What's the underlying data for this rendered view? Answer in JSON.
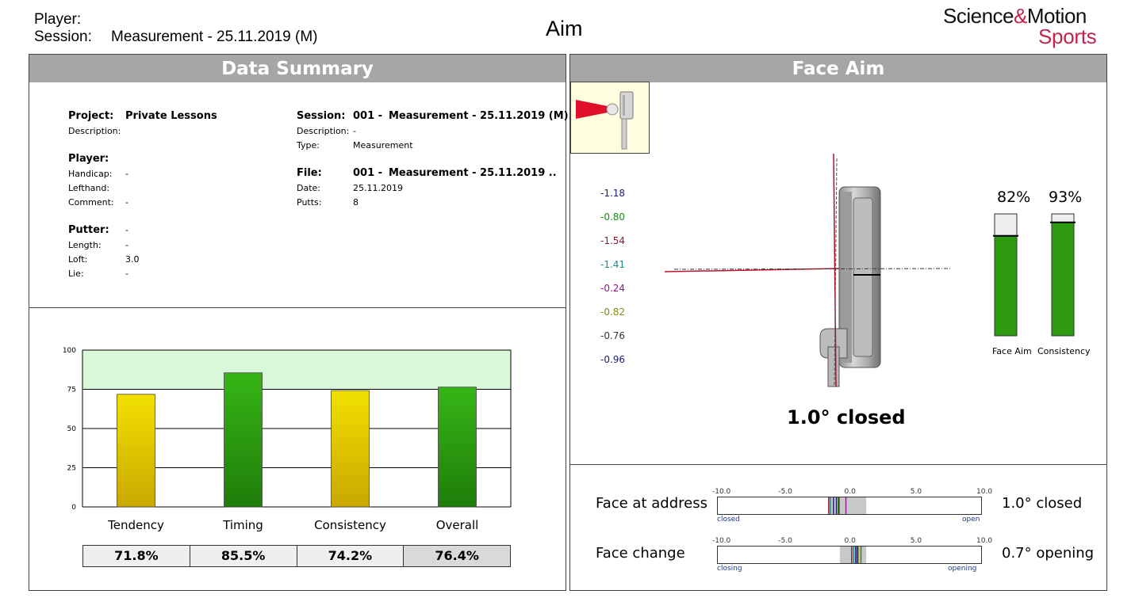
{
  "header": {
    "player_label": "Player:",
    "session_label": "Session:",
    "session_value": "Measurement - 25.11.2019 (M)",
    "title": "Aim",
    "logo_top_1": "Science",
    "logo_amp": "&",
    "logo_top_2": "Motion",
    "logo_bottom": "Sports"
  },
  "summary": {
    "heading": "Data Summary",
    "project_label": "Project:",
    "project_value": "Private Lessons",
    "description_label": "Description:",
    "player_label": "Player:",
    "handicap_label": "Handicap:",
    "handicap_value": "-",
    "lefthand_label": "Lefthand:",
    "comment_label": "Comment:",
    "comment_value": "-",
    "putter_label": "Putter:",
    "putter_value": "-",
    "length_label": "Length:",
    "length_value": "-",
    "loft_label": "Loft:",
    "loft_value": "3.0",
    "lie_label": "Lie:",
    "lie_value": "-",
    "session_label": "Session:",
    "session_num": "001 -",
    "session_value": "Measurement - 25.11.2019 (M)",
    "session_desc_label": "Description:",
    "session_desc_value": "-",
    "type_label": "Type:",
    "type_value": "Measurement",
    "file_label": "File:",
    "file_num": "001 -",
    "file_value": "Measurement - 25.11.2019 ..",
    "date_label": "Date:",
    "date_value": "25.11.2019",
    "putts_label": "Putts:",
    "putts_value": "8"
  },
  "chart_data": {
    "type": "bar",
    "categories": [
      "Tendency",
      "Timing",
      "Consistency",
      "Overall"
    ],
    "values": [
      71.8,
      85.5,
      74.2,
      76.4
    ],
    "value_labels": [
      "71.8%",
      "85.5%",
      "74.2%",
      "76.4%"
    ],
    "bar_colors": [
      "#e6cf00",
      "#2f9e10",
      "#e6cf00",
      "#2f9e10"
    ],
    "ylim": [
      0,
      100
    ],
    "yticks": [
      "0",
      "25",
      "50",
      "75",
      "100"
    ],
    "target_band": [
      75,
      100
    ],
    "target_band_color": "#d9f7d9",
    "grid": true
  },
  "face_aim": {
    "heading": "Face Aim",
    "values": [
      {
        "text": "-1.18",
        "color": "#1c1c6e"
      },
      {
        "text": "-0.80",
        "color": "#1a8a1a"
      },
      {
        "text": "-1.54",
        "color": "#8a1a2a"
      },
      {
        "text": "-1.41",
        "color": "#1a8a8a"
      },
      {
        "text": "-0.24",
        "color": "#8a1a8a"
      },
      {
        "text": "-0.82",
        "color": "#8a8a1a"
      },
      {
        "text": "-0.76",
        "color": "#333333"
      },
      {
        "text": "-0.96",
        "color": "#1c1c6e"
      }
    ],
    "result": "1.0° closed",
    "gauges": [
      {
        "label": "Face Aim",
        "pct_text": "82%",
        "pct": 82
      },
      {
        "label": "Consistency",
        "pct_text": "93%",
        "pct": 93
      }
    ]
  },
  "face_bars": {
    "scale_ticks": [
      "-10.0",
      "-5.0",
      "0.0",
      "5.0",
      "10.0"
    ],
    "address": {
      "label": "Face at address",
      "result": "1.0° closed",
      "left_end": "closed",
      "right_end": "open",
      "range": [
        -1.6,
        1.3
      ],
      "marks": [
        -1.54,
        -1.41,
        -1.18,
        -0.96,
        -0.82,
        -0.8,
        -0.76,
        -0.24
      ]
    },
    "change": {
      "label": "Face change",
      "result": "0.7° opening",
      "left_end": "closing",
      "right_end": "opening",
      "range": [
        -0.7,
        1.3
      ],
      "marks": [
        0.2,
        0.35,
        0.5,
        0.62,
        0.7,
        0.9
      ]
    }
  }
}
